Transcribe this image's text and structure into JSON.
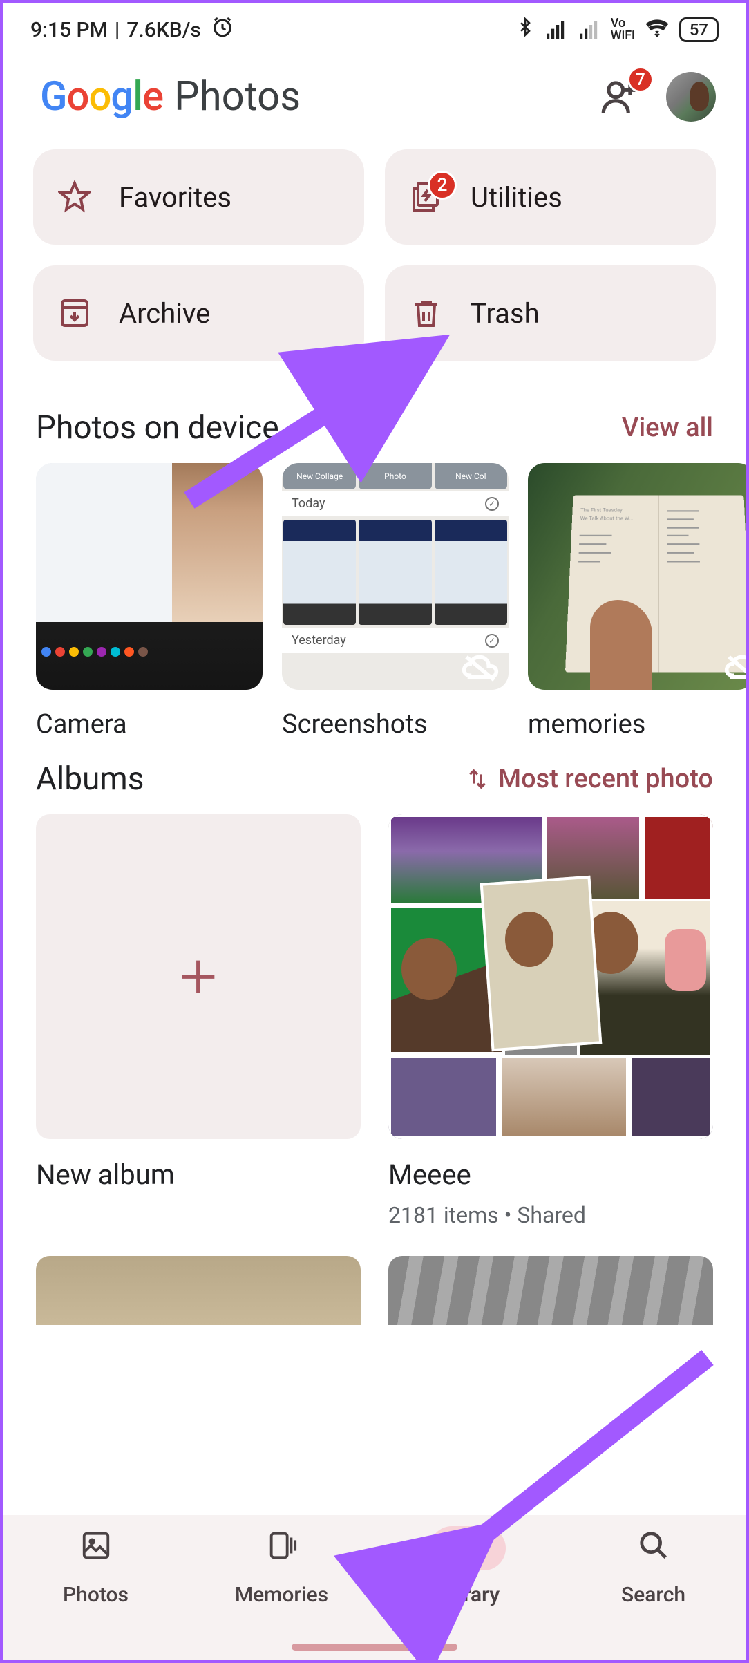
{
  "status_bar": {
    "time": "9:15 PM",
    "separator": "|",
    "net_speed": "7.6KB/s",
    "vo_label_top": "Vo",
    "vo_label_bottom": "WiFi",
    "battery_percent": "57"
  },
  "header": {
    "google_g": "G",
    "google_o1": "o",
    "google_o2": "o",
    "google_g2": "g",
    "google_l": "l",
    "google_e": "e",
    "photos_word": "Photos",
    "sharing_badge": "7"
  },
  "chips": {
    "favorites": "Favorites",
    "utilities": "Utilities",
    "utilities_badge": "2",
    "archive": "Archive",
    "trash": "Trash"
  },
  "device_section": {
    "title": "Photos on device",
    "view_all": "View all",
    "items": [
      {
        "label": "Camera"
      },
      {
        "label": "Screenshots"
      },
      {
        "label": "memories"
      }
    ],
    "ss_today": "Today",
    "ss_yesterday": "Yesterday",
    "ss_chip1": "New Collage",
    "ss_chip2": "Photo",
    "ss_chip3": "New Col"
  },
  "albums_section": {
    "title": "Albums",
    "sort_label": "Most recent photo",
    "new_album": "New album",
    "album1_title": "Meeee",
    "album1_sub": "2181 items  •  Shared"
  },
  "nav": {
    "photos": "Photos",
    "memories": "Memories",
    "library": "Library",
    "search": "Search"
  }
}
